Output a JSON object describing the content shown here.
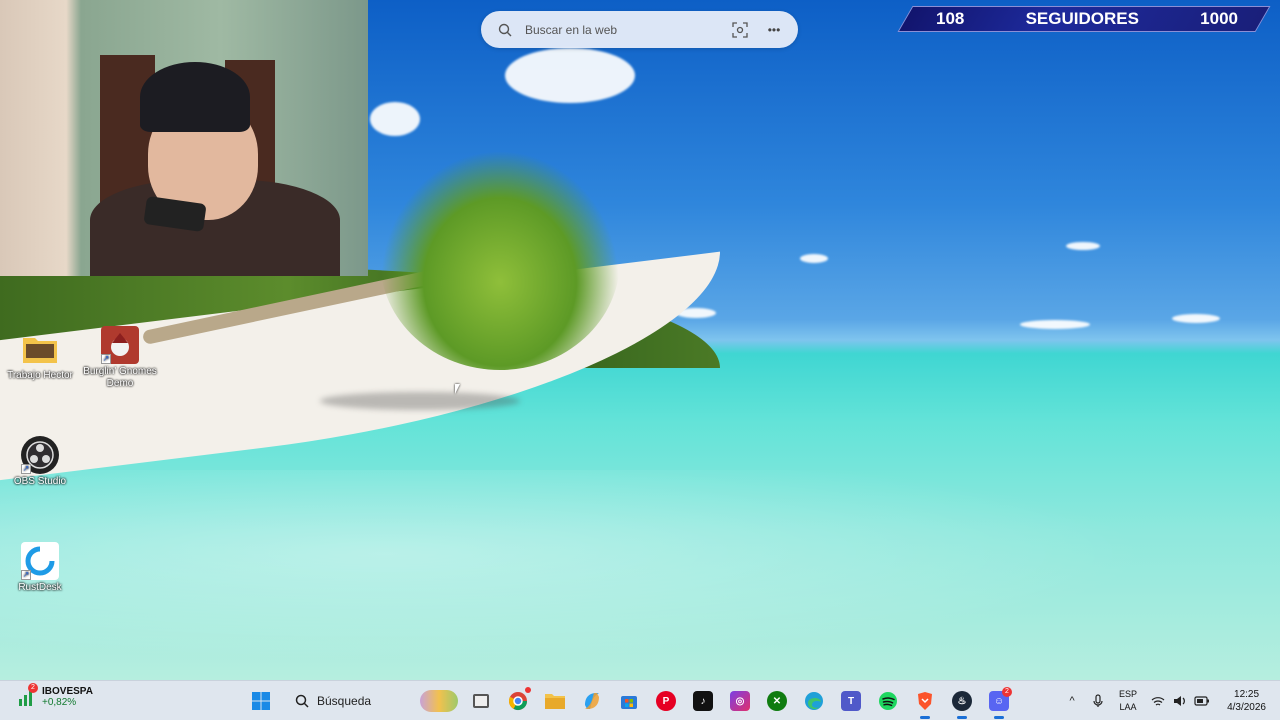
{
  "search": {
    "placeholder": "Buscar en la web"
  },
  "followers": {
    "current": "108",
    "label": "SEGUIDORES",
    "goal": "1000"
  },
  "desktop_icons": [
    {
      "label": "Trabajo Hector"
    },
    {
      "label": "Burglin' Gnomes Demo"
    },
    {
      "label": "OBS Studio"
    },
    {
      "label": "RustDesk"
    }
  ],
  "taskbar": {
    "widget": {
      "name": "IBOVESPA",
      "change": "+0,82%",
      "badge": "2"
    },
    "search_label": "Búsqueda",
    "apps": [
      "start",
      "search",
      "widgets-thumbnail",
      "task-view",
      "chrome",
      "file-explorer",
      "copilot",
      "ms-store",
      "pinterest",
      "tiktok",
      "instagram",
      "xbox",
      "edge",
      "teams",
      "spotify",
      "brave",
      "steam",
      "discord"
    ],
    "discord_badge": "2"
  },
  "tray": {
    "lang_top": "ESP",
    "lang_bottom": "LAA",
    "time": "12:25",
    "date": "4/3/2026"
  },
  "colors": {
    "taskbar_bg": "#dfe6ee",
    "accent": "#1a6fd6",
    "followers_bg": "#1d2a9c"
  }
}
